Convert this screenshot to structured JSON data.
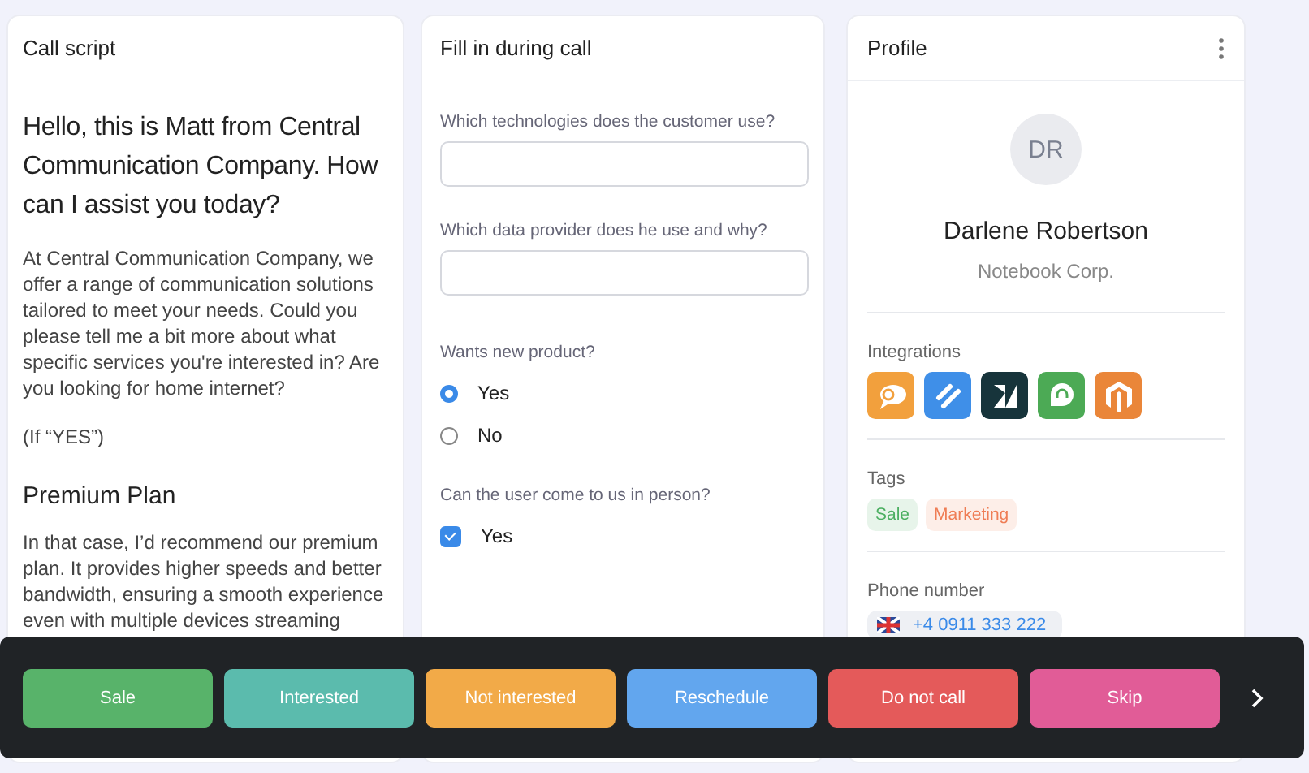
{
  "call_script": {
    "title": "Call script",
    "greeting": "Hello, this is Matt from Central Communication Company. How can I assist you today?",
    "intro": "At Central Communication Company, we offer a range of communication solutions tailored to meet your needs. Could you please tell me a bit more about what specific services you're interested in? Are you looking for home internet?",
    "condition": "(If “YES”)",
    "plan_title": "Premium Plan",
    "plan_text": "In that case, I’d recommend our premium plan. It provides higher speeds and better bandwidth, ensuring a smooth experience even with multiple devices streaming"
  },
  "form": {
    "title": "Fill in during call",
    "questions": [
      {
        "kind": "text",
        "label": "Which technologies does the customer use?"
      },
      {
        "kind": "text",
        "label": "Which data provider does he use and why?"
      },
      {
        "kind": "radio",
        "label": "Wants new product?",
        "options": [
          {
            "label": "Yes",
            "selected": true
          },
          {
            "label": "No",
            "selected": false
          }
        ]
      },
      {
        "kind": "checkbox",
        "label": "Can the user come to us in person?",
        "options": [
          {
            "label": "Yes",
            "checked": true
          }
        ]
      }
    ]
  },
  "profile": {
    "title": "Profile",
    "initials": "DR",
    "name": "Darlene Robertson",
    "company": "Notebook Corp.",
    "integrations_label": "Integrations",
    "integrations": [
      {
        "kind": "chat",
        "color": "#f2a03d"
      },
      {
        "kind": "slashes",
        "color": "#3f8fe8"
      },
      {
        "kind": "zen",
        "color": "#17343b"
      },
      {
        "kind": "headset",
        "color": "#4caa55"
      },
      {
        "kind": "magento",
        "color": "#ea8639"
      }
    ],
    "tags_label": "Tags",
    "tags": [
      {
        "label": "Sale",
        "color": "#4caf62"
      },
      {
        "label": "Marketing",
        "color": "#ef7d55"
      }
    ],
    "phone_label": "Phone number",
    "phone": "+4 0911 333 222"
  },
  "actions": [
    {
      "label": "Sale",
      "color": "#58b36a"
    },
    {
      "label": "Interested",
      "color": "#5bbbad"
    },
    {
      "label": "Not interested",
      "color": "#f2aa48"
    },
    {
      "label": "Reschedule",
      "color": "#62a6ee"
    },
    {
      "label": "Do not call",
      "color": "#e45a5a"
    },
    {
      "label": "Skip",
      "color": "#e15c97"
    }
  ]
}
